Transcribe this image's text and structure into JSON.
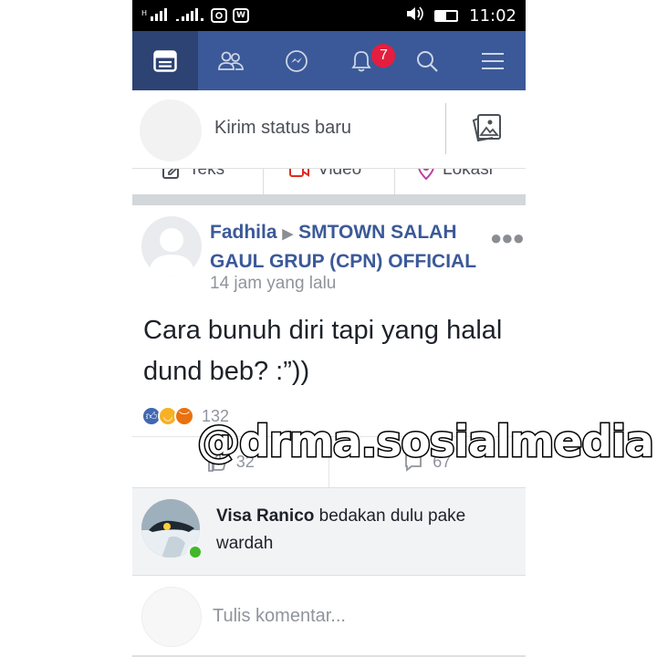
{
  "status_bar": {
    "network_left": "H",
    "network_right": "₁",
    "app_icon_1": "instagram-icon",
    "app_icon_2": "w-app-icon",
    "time": "11:02",
    "icons": [
      "volume-icon",
      "battery-icon"
    ]
  },
  "nav": {
    "items": [
      "news-feed-icon",
      "friends-icon",
      "messenger-icon",
      "notifications-icon",
      "search-icon",
      "menu-icon"
    ],
    "notification_count": "7",
    "active_index": 0
  },
  "composer": {
    "placeholder": "Kirim status baru",
    "quick_actions": [
      "Teks",
      "Video",
      "Lokasi"
    ]
  },
  "post": {
    "author": "Fadhila",
    "group": "SMTOWN SALAH GAUL GRUP (CPN) OFFICIAL",
    "time": "14 jam yang lalu",
    "text": "Cara bunuh diri tapi yang halal dund beb? :”))",
    "reaction_count": "132",
    "like_count": "32",
    "comment_count": "67",
    "colors": {
      "link": "#3b5998",
      "like": "#4267b2",
      "haha": "#f7b125",
      "angry": "#e9710f"
    }
  },
  "comment": {
    "author": "Visa Ranico",
    "text": "bedakan dulu pake wardah"
  },
  "write_comment": {
    "placeholder": "Tulis komentar..."
  },
  "watermark": "@drma.sosialmedia",
  "colors": {
    "brand": "#3b5998",
    "badge": "#e41e3f",
    "online": "#42b72a"
  }
}
